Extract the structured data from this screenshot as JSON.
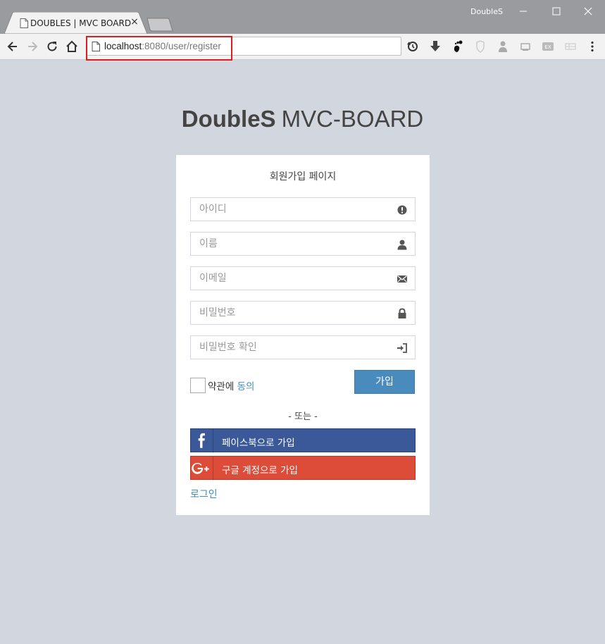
{
  "browser": {
    "tab_title": "DOUBLES | MVC BOARD",
    "tab_close": "×",
    "window_title": "DoubleS",
    "url_host": "localhost",
    "url_rest": ":8080/user/register"
  },
  "extensions": [
    "sync-icon",
    "download-icon",
    "gnome-icon",
    "shield-icon",
    "person-icon",
    "screen-icon",
    "ex-icon",
    "sheet-icon",
    "menu-icon"
  ],
  "page": {
    "logo_bold": "DoubleS",
    "logo_light": "MVC-BOARD"
  },
  "form": {
    "title": "회원가입 페이지",
    "id_placeholder": "아이디",
    "name_placeholder": "이름",
    "email_placeholder": "이메일",
    "password_placeholder": "비밀번호",
    "password_confirm_placeholder": "비밀번호 확인",
    "agree_prefix": "약관에 ",
    "agree_link": "동의",
    "join_label": "가입",
    "or_text": "- 또는 -",
    "facebook_label": "페이스북으로 가입",
    "google_label": "구글 계정으로 가입",
    "login_link": "로그인"
  },
  "colors": {
    "background": "#d2d6de",
    "accent": "#3c8dbc",
    "join_button": "#4a8bbd",
    "facebook": "#3b5998",
    "google": "#dd4b39",
    "highlight": "#e01b1b"
  }
}
